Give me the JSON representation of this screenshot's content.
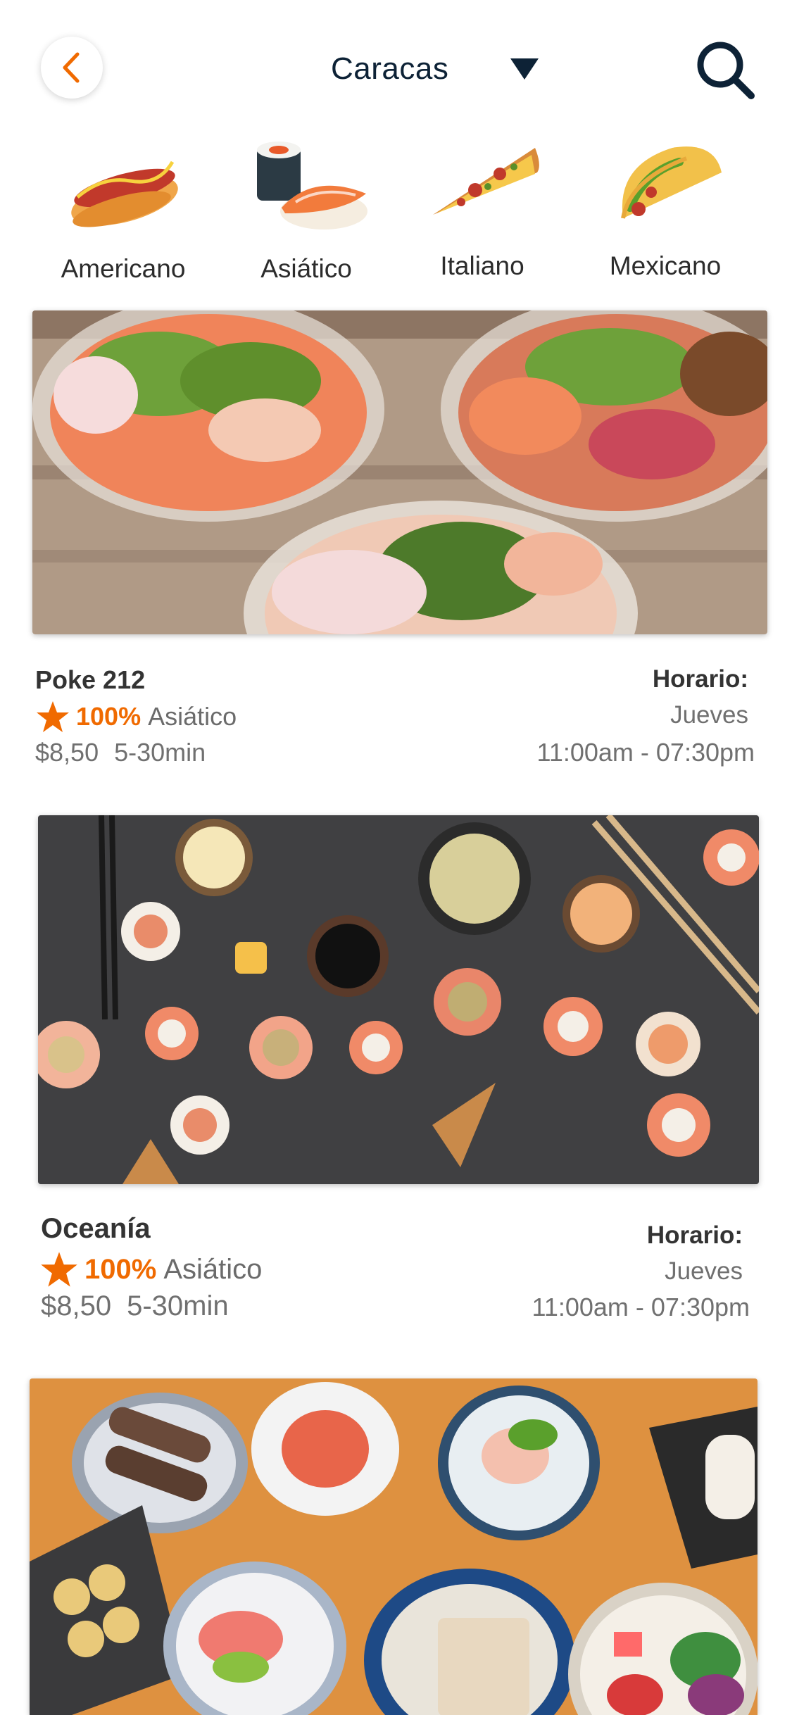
{
  "header": {
    "city": "Caracas",
    "back_icon": "chevron-left-icon",
    "search_icon": "search-icon",
    "accent": "#f06a00",
    "dark": "#0d2236"
  },
  "categories": [
    {
      "label": "Americano",
      "icon": "hotdog-icon"
    },
    {
      "label": "Asiático",
      "icon": "sushi-icon"
    },
    {
      "label": "Italiano",
      "icon": "pizza-icon"
    },
    {
      "label": "Mexicano",
      "icon": "taco-icon"
    }
  ],
  "restaurants": [
    {
      "name": "Poke 212",
      "rating": "100%",
      "cuisine": "Asiático",
      "price": "$8,50",
      "time": "5-30min",
      "schedule_title": "Horario:",
      "schedule_day": "Jueves",
      "schedule_hours": "11:00am - 07:30pm"
    },
    {
      "name": "Oceanía",
      "rating": "100%",
      "cuisine": "Asiático",
      "price": "$8,50",
      "time": "5-30min",
      "schedule_title": "Horario:",
      "schedule_day": "Jueves",
      "schedule_hours": "11:00am - 07:30pm"
    }
  ]
}
